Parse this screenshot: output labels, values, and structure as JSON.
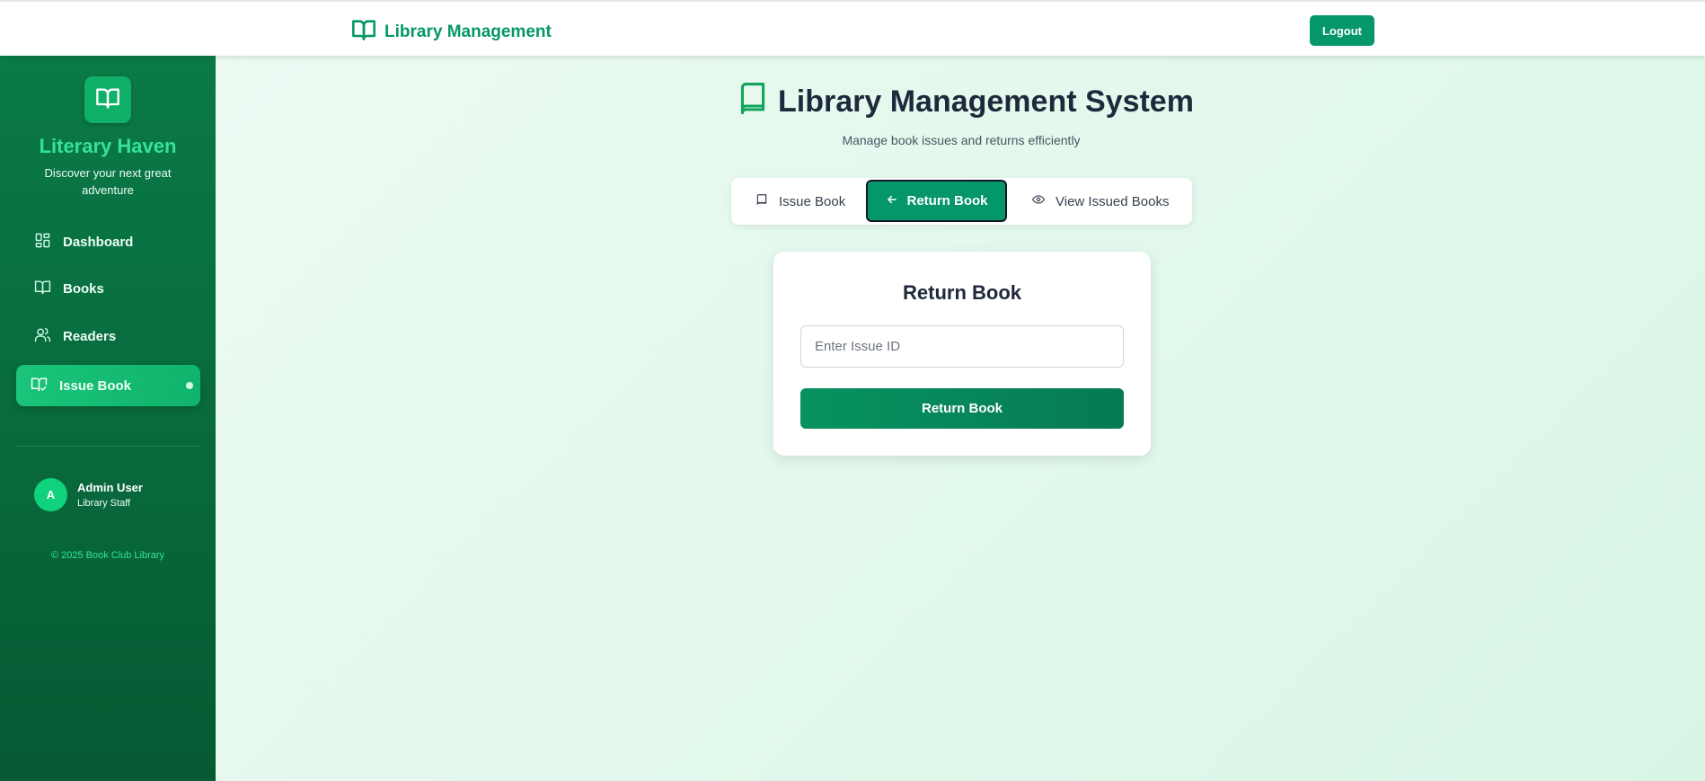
{
  "topbar": {
    "brand_icon": "book-open-icon",
    "brand_label": "Library Management",
    "logout_label": "Logout"
  },
  "sidebar": {
    "logo_icon": "book-open-icon",
    "title": "Literary Haven",
    "subtitle": "Discover your next great adventure",
    "items": [
      {
        "label": "Dashboard",
        "icon": "dashboard-grid-icon",
        "active": false
      },
      {
        "label": "Books",
        "icon": "book-open-icon",
        "active": false
      },
      {
        "label": "Readers",
        "icon": "users-icon",
        "active": false
      },
      {
        "label": "Issue Book",
        "icon": "book-check-icon",
        "active": true
      }
    ],
    "user": {
      "initial": "A",
      "name": "Admin User",
      "role": "Library Staff"
    },
    "copyright": "© 2025 Book Club Library"
  },
  "main": {
    "title_icon": "book-icon",
    "title": "Library Management System",
    "subtitle": "Manage book issues and returns efficiently",
    "tabs": [
      {
        "label": "Issue Book",
        "icon": "book-icon",
        "active": false
      },
      {
        "label": "Return Book",
        "icon": "arrow-left-icon",
        "active": true
      },
      {
        "label": "View Issued Books",
        "icon": "eye-icon",
        "active": false
      }
    ],
    "card": {
      "title": "Return Book",
      "input_placeholder": "Enter Issue ID",
      "input_value": "",
      "button_label": "Return Book"
    }
  },
  "colors": {
    "accent": "#059669",
    "sidebar_bg": "#086b3d",
    "sidebar_active": "#10b36b",
    "sidebar_title": "#34e39a",
    "main_bg": "#e2f8ec"
  }
}
